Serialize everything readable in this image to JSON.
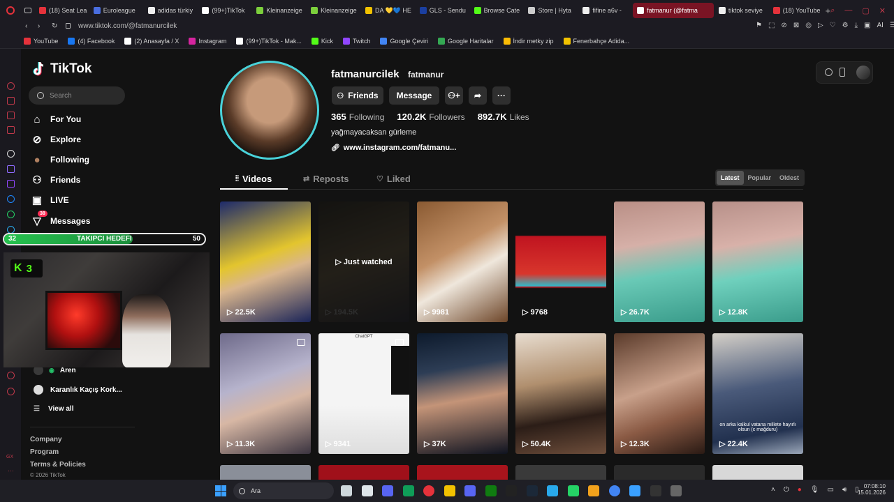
{
  "browser": {
    "tabs": [
      {
        "label": "(18) Seat Lea",
        "color": "#e5323b"
      },
      {
        "label": "Euroleague",
        "color": "#4a6ee0"
      },
      {
        "label": "adidas türkiy",
        "color": "#eeeeee"
      },
      {
        "label": "(99+)TikTok",
        "color": "#ffffff"
      },
      {
        "label": "Kleinanzeige",
        "color": "#7ccf3c"
      },
      {
        "label": "Kleinanzeige",
        "color": "#7ccf3c"
      },
      {
        "label": "DA 💛💙 HE",
        "color": "#f2c200"
      },
      {
        "label": "GLS - Sendu",
        "color": "#1b3fa0"
      },
      {
        "label": "Browse Cate",
        "color": "#53fc18"
      },
      {
        "label": "Store | Hyta",
        "color": "#cccccc"
      },
      {
        "label": "fifine a6v - ",
        "color": "#eeeeee"
      },
      {
        "label": "fatmanur (@fatma",
        "color": "#ffffff",
        "active": true
      },
      {
        "label": "tiktok seviye",
        "color": "#eeeeee"
      },
      {
        "label": "(18) YouTube",
        "color": "#e5323b"
      }
    ],
    "new_tab_label": "+",
    "url": "www.tiktok.com/@fatmanurcilek",
    "ai_label": "AI",
    "bookmarks": [
      {
        "label": "YouTube",
        "color": "#e5323b"
      },
      {
        "label": "(4) Facebook",
        "color": "#1877f2"
      },
      {
        "label": "(2) Anasayfa / X",
        "color": "#ffffff"
      },
      {
        "label": "Instagram",
        "color": "#d6249f"
      },
      {
        "label": "(99+)TikTok - Mak...",
        "color": "#ffffff"
      },
      {
        "label": "Kick",
        "color": "#53fc18"
      },
      {
        "label": "Twitch",
        "color": "#9146ff"
      },
      {
        "label": "Google Çeviri",
        "color": "#4285f4"
      },
      {
        "label": "Google Haritalar",
        "color": "#34a853"
      },
      {
        "label": "İndir metky zip",
        "color": "#fbbc05"
      },
      {
        "label": "Fenerbahçe Adida...",
        "color": "#f2c200"
      }
    ]
  },
  "sidebar": {
    "logo": "TikTok",
    "search_placeholder": "Search",
    "nav": [
      {
        "label": "For You",
        "icon": "home-icon"
      },
      {
        "label": "Explore",
        "icon": "compass-icon"
      },
      {
        "label": "Following",
        "icon": "avatar-icon"
      },
      {
        "label": "Friends",
        "icon": "friends-icon"
      },
      {
        "label": "LIVE",
        "icon": "live-icon"
      },
      {
        "label": "Messages",
        "icon": "message-icon",
        "badge": "38"
      }
    ],
    "following_accounts": [
      "Aren",
      "Karanlık Kaçış Kork..."
    ],
    "view_all": "View all",
    "footer": [
      "Company",
      "Program",
      "Terms & Policies",
      "© 2026 TikTok"
    ]
  },
  "profile": {
    "username": "fatmanurcilek",
    "nickname": "fatmanur",
    "buttons": {
      "friends": "Friends",
      "message": "Message"
    },
    "stats": [
      {
        "value": "365",
        "label": "Following"
      },
      {
        "value": "120.2K",
        "label": "Followers"
      },
      {
        "value": "892.7K",
        "label": "Likes"
      }
    ],
    "bio": "yağmayacaksan gürleme",
    "link": "www.instagram.com/fatmanu..."
  },
  "content_tabs": [
    "Videos",
    "Reposts",
    "Liked"
  ],
  "sort": [
    "Latest",
    "Popular",
    "Oldest"
  ],
  "videos": [
    {
      "views": "22.5K",
      "bg": "linear-gradient(160deg,#1d2a6b 0%,#e3c52e 45%,#d9b58d 60%,#1a2458 100%)"
    },
    {
      "views": "194.5K",
      "bg": "linear-gradient(160deg,#2c2a24 0%,#4d4536 50%,#2a2a30 100%)",
      "dim": true,
      "overlay": "Just watched"
    },
    {
      "views": "9981",
      "bg": "linear-gradient(150deg,#8a5a32 0%,#c29066 40%,#efe7dc 60%,#6d4528 100%)"
    },
    {
      "views": "9768",
      "bg": "linear-gradient(180deg,#121212 0%,#121212 28%,#c01420 29%,#d8362c 60%,#34b7c6 70%,#c01420 71%,#121212 72%,#121212 100%)"
    },
    {
      "views": "26.7K",
      "bg": "linear-gradient(170deg,#b98f86 0%,#d6b0a8 35%,#69c9b6 60%,#3a9c8b 100%)"
    },
    {
      "views": "12.8K",
      "bg": "linear-gradient(170deg,#b79089 0%,#d8b1a9 35%,#6fd0bd 60%,#3a9c8b 100%)"
    },
    {
      "views": "11.3K",
      "bg": "linear-gradient(160deg,#6e6a8a 0%,#b6b3cc 40%,#d7b7a4 60%,#3b3440 100%)",
      "pinned": true
    },
    {
      "views": "9341",
      "bg": "linear-gradient(180deg,#f4f4f4 0%,#f4f4f4 60%,#dedede 100%)",
      "pinned": true,
      "caption": "ChatGPT"
    },
    {
      "views": "37K",
      "bg": "linear-gradient(170deg,#0d1a2c 0%,#2d3d55 30%,#c49478 55%,#0f1320 100%)"
    },
    {
      "views": "50.4K",
      "bg": "linear-gradient(170deg,#e8ddd0 0%,#b08f6e 40%,#2b1d17 70%,#6e4e3b 100%)"
    },
    {
      "views": "12.3K",
      "bg": "linear-gradient(160deg,#5a3a2a 0%,#c8a08a 45%,#8a5a44 70%,#2a1a14 100%)"
    },
    {
      "views": "22.4K",
      "bg": "linear-gradient(170deg,#d5d0c8 0%,#4a5a7a 45%,#22314f 80%,#9aa6b8 100%)",
      "caption2": "on arka kalkul vatana millete hayırlı olsun (c mağduru)"
    }
  ],
  "overlay": {
    "goal_left": "32",
    "goal_label": "TAKIPCI HEDEFI",
    "goal_right": "50",
    "goal_progress": 0.64,
    "kick_count": "3"
  },
  "taskbar": {
    "search_placeholder": "Ara",
    "time": "07:08:10",
    "date": "15.01.2026"
  }
}
